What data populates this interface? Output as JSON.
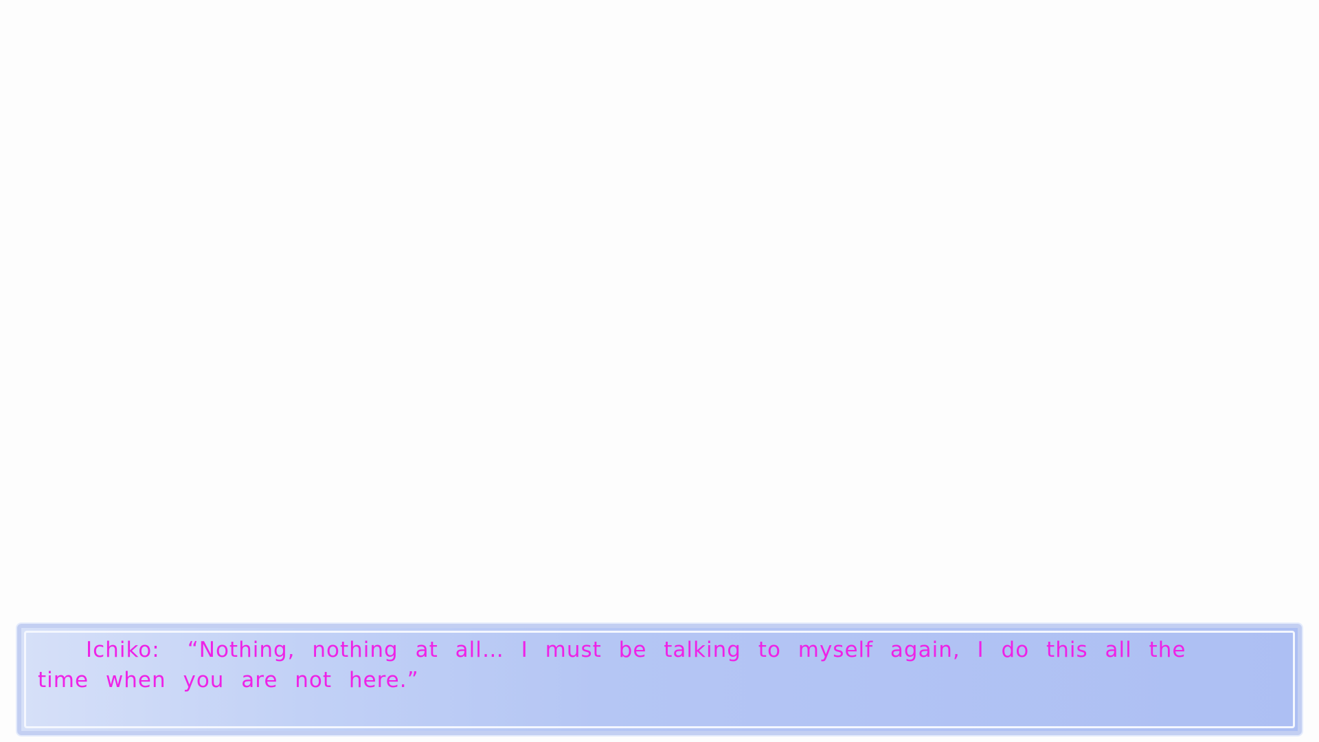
{
  "dialogue": {
    "speaker": "Ichiko:",
    "line": "“Nothing, nothing at all… I must be talking to myself again, I do this all the time when you are not here.”"
  },
  "colors": {
    "text": "#ee22e6",
    "box_start": "#d6e0f8",
    "box_end": "#adbff3",
    "background": "#fdfdfd"
  }
}
